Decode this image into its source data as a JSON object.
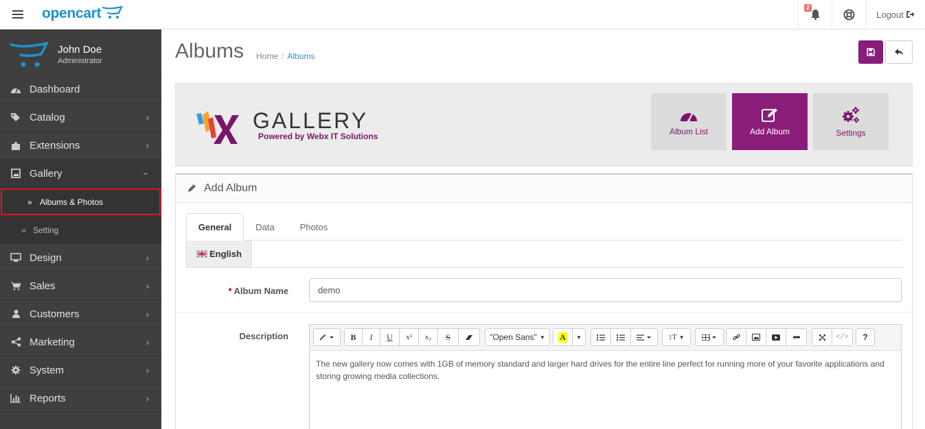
{
  "header": {
    "logo_text": "opencart",
    "notification_count": "2",
    "logout_label": "Logout"
  },
  "profile": {
    "name": "John Doe",
    "role": "Administrator"
  },
  "sidebar": {
    "items": [
      {
        "label": "Dashboard",
        "icon": "dashboard-icon"
      },
      {
        "label": "Catalog",
        "icon": "tags-icon"
      },
      {
        "label": "Extensions",
        "icon": "puzzle-icon"
      },
      {
        "label": "Gallery",
        "icon": "image-icon"
      },
      {
        "label": "Design",
        "icon": "desktop-icon"
      },
      {
        "label": "Sales",
        "icon": "cart-icon"
      },
      {
        "label": "Customers",
        "icon": "user-icon"
      },
      {
        "label": "Marketing",
        "icon": "share-icon"
      },
      {
        "label": "System",
        "icon": "cog-icon"
      },
      {
        "label": "Reports",
        "icon": "bar-chart-icon"
      }
    ],
    "gallery_sub": [
      {
        "label": "Albums & Photos"
      },
      {
        "label": "Setting"
      }
    ]
  },
  "page": {
    "title": "Albums",
    "breadcrumb": [
      "Home",
      "Albums"
    ]
  },
  "banner": {
    "logo_text": "GALLERY",
    "powered_by": "Powered by Webx IT Solutions",
    "tiles": [
      {
        "label": "Album List",
        "icon": "tachometer-icon"
      },
      {
        "label": "Add Album",
        "icon": "edit-icon"
      },
      {
        "label": "Settings",
        "icon": "cogs-icon"
      }
    ],
    "active_color": "#8b1d7a"
  },
  "panel": {
    "title": "Add Album",
    "tabs": [
      "General",
      "Data",
      "Photos"
    ],
    "language_tab": "English",
    "album_name_label": "Album Name",
    "album_name_value": "demo",
    "description_label": "Description",
    "font_select": "\"Open Sans\"",
    "description_text": "The new gallery now comes with 1GB of memory standard and larger hard drives for the entire line perfect for running more of your favorite applications and storing growing media collections."
  }
}
